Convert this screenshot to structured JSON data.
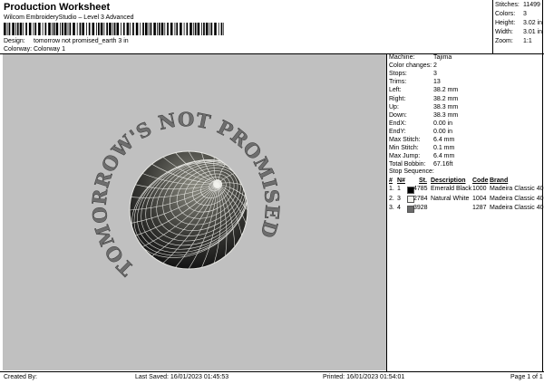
{
  "header": {
    "title": "Production Worksheet",
    "subtitle": "Wilcom EmbroideryStudio – Level 3 Advanced",
    "design_label": "Design:",
    "design_value": "tomorrow not promised_earth 3 in",
    "colorway_label": "Colorway:",
    "colorway_value": "Colorway 1"
  },
  "stats": [
    {
      "label": "Stitches:",
      "value": "11499"
    },
    {
      "label": "Colors:",
      "value": "3"
    },
    {
      "label": "Height:",
      "value": "3.02 in"
    },
    {
      "label": "Width:",
      "value": "3.01 in"
    },
    {
      "label": "Zoom:",
      "value": "1:1"
    }
  ],
  "design_text": "TOMORROW'S NOT PROMISED",
  "machine_info": [
    {
      "label": "Machine:",
      "value": "Tajima"
    },
    {
      "label": "Color changes:",
      "value": "2"
    },
    {
      "label": "Stops:",
      "value": "3"
    },
    {
      "label": "Trims:",
      "value": "13"
    },
    {
      "label": "Left:",
      "value": "38.2 mm"
    },
    {
      "label": "Right:",
      "value": "38.2 mm"
    },
    {
      "label": "Up:",
      "value": "38.3 mm"
    },
    {
      "label": "Down:",
      "value": "38.3 mm"
    },
    {
      "label": "EndX:",
      "value": "0.00 in"
    },
    {
      "label": "EndY:",
      "value": "0.00 in"
    },
    {
      "label": "Max Stitch:",
      "value": "6.4 mm"
    },
    {
      "label": "Min Stitch:",
      "value": "0.1 mm"
    },
    {
      "label": "Max Jump:",
      "value": "6.4 mm"
    },
    {
      "label": "Total Bobbin:",
      "value": "67.16ft"
    }
  ],
  "stop_sequence": {
    "title": "Stop Sequence:",
    "headers": [
      "#",
      "N#",
      "St.",
      "Description",
      "Code",
      "Brand"
    ],
    "rows": [
      {
        "num": "1.",
        "n": "1",
        "st": "4785",
        "desc": "Emerald Black",
        "code": "1000",
        "brand": "Madeira Classic 40",
        "color": "#000000"
      },
      {
        "num": "2.",
        "n": "3",
        "st": "2784",
        "desc": "Natural White",
        "code": "1004",
        "brand": "Madeira Classic 40",
        "color": "#f4f4f0"
      },
      {
        "num": "3.",
        "n": "4",
        "st": "3928",
        "desc": "",
        "code": "1287",
        "brand": "Madeira Classic 40",
        "color": "#6b6b6b"
      }
    ]
  },
  "footer": {
    "created_by": "Created By:",
    "last_saved": "Last Saved: 16/01/2023 01:45:53",
    "printed": "Printed: 16/01/2023 01:54:01",
    "page": "Page 1 of 1"
  },
  "colors": {
    "design_background": "#c0c0c0",
    "text_fill": "#6e6e6e",
    "globe_line": "#f2f2ee",
    "globe_dark": "#1c1c1c"
  }
}
